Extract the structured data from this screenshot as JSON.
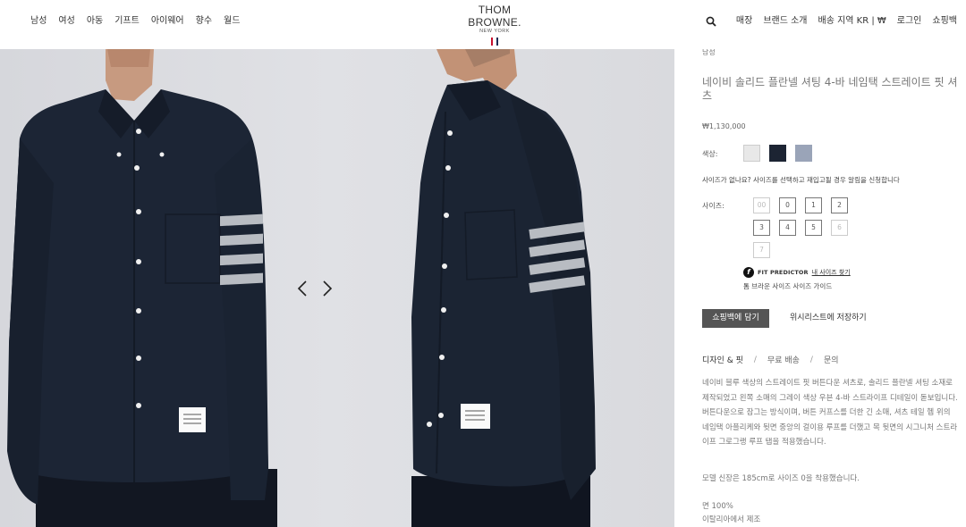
{
  "header": {
    "nav_left": [
      "남성",
      "여성",
      "아동",
      "기프트",
      "아이웨어",
      "향수",
      "월드"
    ],
    "logo": {
      "main": "THOM BROWNE.",
      "sub": "NEW YORK",
      "flag_colors": [
        "#c8102e",
        "#ffffff",
        "#1d2b55"
      ]
    },
    "search_icon": "search-icon",
    "nav_right": [
      "매장",
      "브랜드 소개",
      "배송 지역 KR | ₩",
      "로그인",
      "쇼핑백"
    ]
  },
  "gallery": {
    "prev_icon": "chevron-left-icon",
    "next_icon": "chevron-right-icon",
    "images": [
      "front-view-photo",
      "side-view-photo"
    ]
  },
  "product": {
    "breadcrumb": "남성",
    "title": "네이비 솔리드 플란넬 셔팅 4-바 네임택 스트레이트 핏 셔츠",
    "price": "₩1,130,000",
    "color_label": "색상:",
    "swatches": [
      {
        "name": "white",
        "color": "#e8e8e8"
      },
      {
        "name": "navy",
        "color": "#1c2433"
      },
      {
        "name": "light-blue",
        "color": "#9aa4b8"
      }
    ],
    "size_notice": "사이즈가 없나요? 사이즈를 선택하고 재입고될 경우 알림을 신청합니다",
    "size_label": "사이즈:",
    "sizes": [
      {
        "label": "00",
        "disabled": true
      },
      {
        "label": "0",
        "disabled": false
      },
      {
        "label": "1",
        "disabled": false
      },
      {
        "label": "2",
        "disabled": false
      },
      {
        "label": "3",
        "disabled": false
      },
      {
        "label": "4",
        "disabled": false
      },
      {
        "label": "5",
        "disabled": false
      },
      {
        "label": "6",
        "disabled": true
      },
      {
        "label": "7",
        "disabled": true
      }
    ],
    "fit_predictor": {
      "brand": "FIT PREDICTOR",
      "link": "내 사이즈 찾기"
    },
    "size_guide": "톰 브라운 사이즈 사이즈 가이드",
    "add_to_bag": "쇼핑백에 담기",
    "add_to_wishlist": "위시리스트에 저장하기",
    "tabs": [
      "디자인 & 핏",
      "무료 배송",
      "문의"
    ],
    "description": "네이비 블루 색상의 스트레이트 핏 버튼다운 셔츠로, 솔리드 플란넬 셔팅 소재로 제작되었고 왼쪽 소매의 그레이 색상 우븐 4-바 스트라이프 디테일이 돋보입니다. 버튼다운으로 잠그는 방식이며, 버튼 커프스를 더한 긴 소매, 셔츠 테일 헴 위의 네임택 아플리케와 뒷면 중앙의 걸이용 루프를 더했고 목 뒷면의 시그니처 스트라이프 그로그랭 루프 탭을 적용했습니다.",
    "model_info": "모델 신장은 185cm로 사이즈 0을 착용했습니다.",
    "material": "면 100%",
    "origin": "이탈리아에서 제조"
  }
}
